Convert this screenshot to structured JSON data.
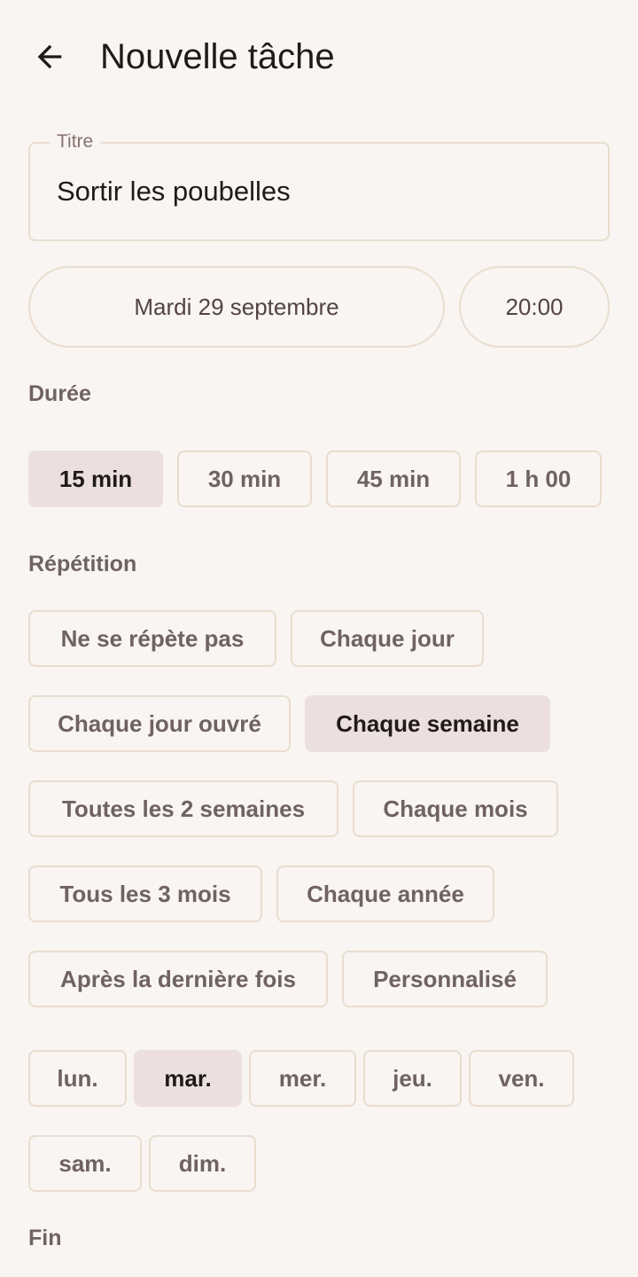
{
  "header": {
    "title": "Nouvelle tâche",
    "back_icon": "arrow-left-icon"
  },
  "title_field": {
    "label": "Titre",
    "value": "Sortir les poubelles"
  },
  "schedule": {
    "date": "Mardi 29 septembre",
    "time": "20:00"
  },
  "duration": {
    "label": "Durée",
    "options": [
      "15 min",
      "30 min",
      "45 min",
      "1 h 00"
    ],
    "selected": "15 min"
  },
  "repetition": {
    "label": "Répétition",
    "options": [
      "Ne se répète pas",
      "Chaque jour",
      "Chaque jour ouvré",
      "Chaque semaine",
      "Toutes les 2 semaines",
      "Chaque mois",
      "Tous les 3 mois",
      "Chaque année",
      "Après la dernière fois",
      "Personnalisé"
    ],
    "selected": "Chaque semaine"
  },
  "weekdays": {
    "options": [
      "lun.",
      "mar.",
      "mer.",
      "jeu.",
      "ven.",
      "sam.",
      "dim."
    ],
    "selected": "mar."
  },
  "end": {
    "label": "Fin"
  },
  "colors": {
    "background": "#f9f5f2",
    "outline": "#e8ddd0",
    "selected_chip": "#ebdfdf",
    "text_primary": "#201a1b",
    "text_secondary": "#6f6264"
  }
}
